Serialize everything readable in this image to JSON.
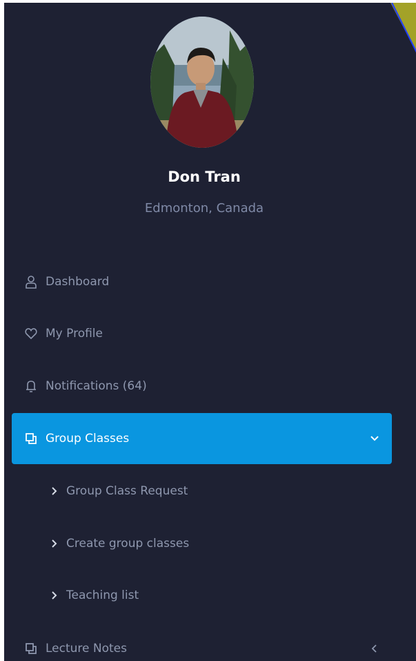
{
  "profile": {
    "name": "Don Tran",
    "location": "Edmonton, Canada"
  },
  "nav": {
    "dashboard": "Dashboard",
    "my_profile": "My Profile",
    "notifications": "Notifications (64)",
    "group_classes": "Group Classes",
    "lecture_notes": "Lecture Notes"
  },
  "submenu": {
    "items": [
      "Group Class Request",
      "Create group classes",
      "Teaching list"
    ]
  },
  "colors": {
    "sidebar_bg": "#1e2133",
    "active_bg": "#0a96e0",
    "muted_text": "#8e97ae",
    "location_text": "#7f89a6"
  },
  "icons": {
    "dashboard": "user-icon",
    "my_profile": "heart-icon",
    "notifications": "bell-icon",
    "group_classes": "copy-icon",
    "lecture_notes": "copy-icon",
    "group_classes_toggle": "chevron-down-icon",
    "lecture_notes_toggle": "chevron-left-icon",
    "submenu_bullet": "chevron-right-icon"
  }
}
